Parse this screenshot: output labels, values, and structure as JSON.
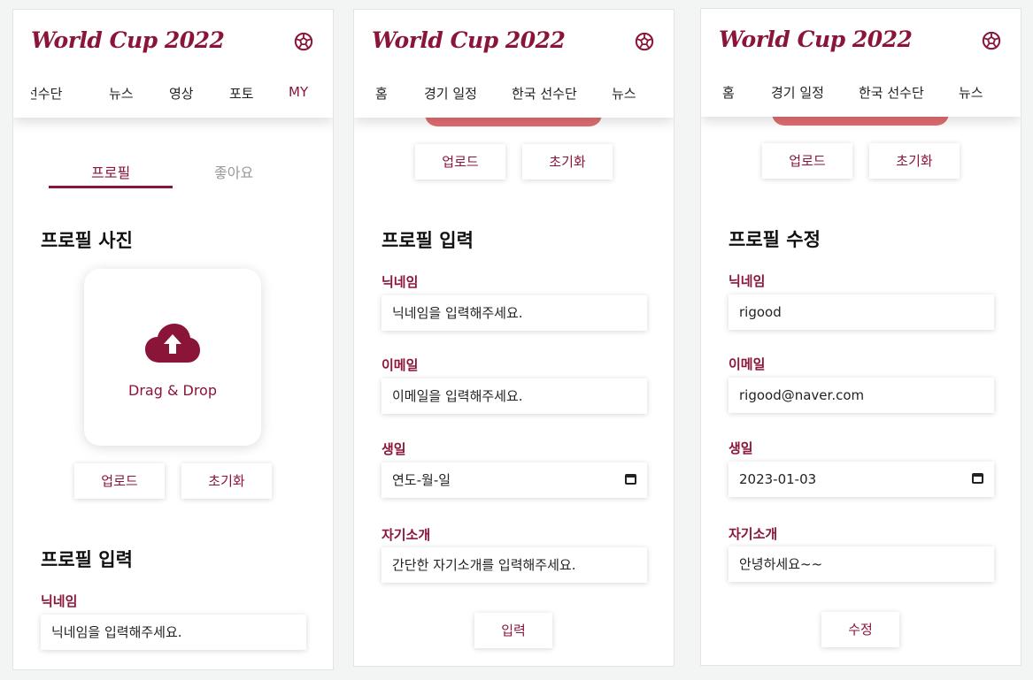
{
  "app": {
    "title": "World Cup 2022",
    "brand_color": "#8a1538",
    "ball_icon": "soccer-ball-icon"
  },
  "panel1": {
    "nav": [
      "선수단",
      "뉴스",
      "영상",
      "포토",
      "MY"
    ],
    "tabs": [
      "프로필",
      "좋아요"
    ],
    "photo_section_title": "프로필 사진",
    "upload_icon": "cloud-upload-icon",
    "drop_text": "Drag & Drop",
    "upload_button": "업로드",
    "reset_button": "초기화",
    "input_section_title": "프로필 입력",
    "nickname_label": "닉네임",
    "nickname_placeholder": "닉네임을 입력해주세요."
  },
  "panel2": {
    "nav": [
      "홈",
      "경기 일정",
      "한국 선수단",
      "뉴스"
    ],
    "upload_button": "업로드",
    "reset_button": "초기화",
    "section_title": "프로필 입력",
    "fields": [
      {
        "label": "닉네임",
        "placeholder": "닉네임을 입력해주세요."
      },
      {
        "label": "이메일",
        "placeholder": "이메일을 입력해주세요."
      },
      {
        "label": "생일",
        "placeholder": "연도-월-일"
      },
      {
        "label": "자기소개",
        "placeholder": "간단한 자기소개를 입력해주세요."
      }
    ],
    "submit_button": "입력"
  },
  "panel3": {
    "nav": [
      "홈",
      "경기 일정",
      "한국 선수단",
      "뉴스"
    ],
    "upload_button": "업로드",
    "reset_button": "초기화",
    "section_title": "프로필 수정",
    "fields": [
      {
        "label": "닉네임",
        "value": "rigood"
      },
      {
        "label": "이메일",
        "value": "rigood@naver.com"
      },
      {
        "label": "생일",
        "value": "2023-01-03"
      },
      {
        "label": "자기소개",
        "value": "안녕하세요~~"
      }
    ],
    "submit_button": "수정"
  }
}
